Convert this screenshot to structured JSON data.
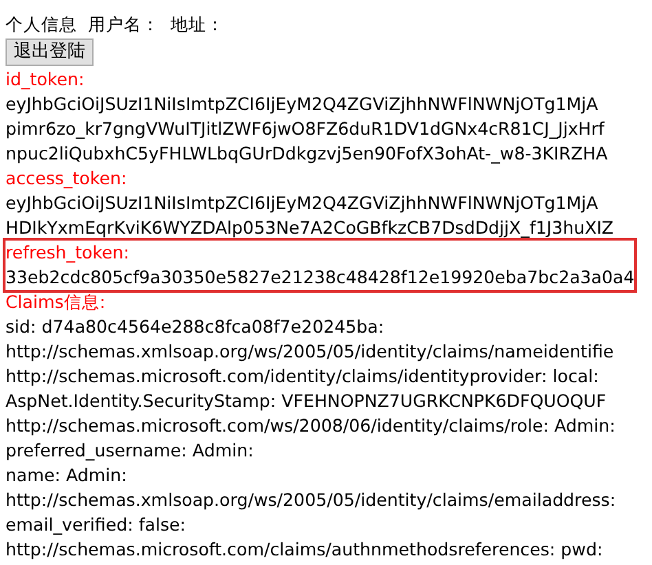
{
  "header": {
    "title": "个人信息",
    "fields": [
      "用户名：",
      "地址："
    ]
  },
  "logout_button": {
    "label": "退出登陆"
  },
  "sections": [
    {
      "label": "id_token:",
      "highlighted": false,
      "lines": [
        "eyJhbGciOiJSUzI1NiIsImtpZCI6IjEyM2Q4ZGViZjhhNWFlNWNjOTg1MjA",
        "pimr6zo_kr7gngVWuITJitlZWF6jwO8FZ6duR1DV1dGNx4cR81CJ_JjxHrf",
        "npuc2liQubxhC5yFHLWLbqGUrDdkgzvj5en90FofX3ohAt-_w8-3KIRZHA"
      ]
    },
    {
      "label": "access_token:",
      "highlighted": false,
      "lines": [
        "eyJhbGciOiJSUzI1NiIsImtpZCI6IjEyM2Q4ZGViZjhhNWFlNWNjOTg1MjA",
        "HDIkYxmEqrKviK6WYZDAlp053Ne7A2CoGBfkzCB7DsdDdjjX_f1J3huXIZ"
      ]
    },
    {
      "label": "refresh_token:",
      "highlighted": true,
      "lines": [
        "33eb2cdc805cf9a30350e5827e21238c48428f12e19920eba7bc2a3a0a4"
      ]
    },
    {
      "label": "Claims信息:",
      "highlighted": false,
      "lines": [
        "sid: d74a80c4564e288c8fca08f7e20245ba:",
        "http://schemas.xmlsoap.org/ws/2005/05/identity/claims/nameidentifie",
        "http://schemas.microsoft.com/identity/claims/identityprovider: local:",
        "AspNet.Identity.SecurityStamp: VFEHNOPNZ7UGRKCNPK6DFQUOQUF",
        "http://schemas.microsoft.com/ws/2008/06/identity/claims/role: Admin:",
        "preferred_username: Admin:",
        "name: Admin:",
        "http://schemas.xmlsoap.org/ws/2005/05/identity/claims/emailaddress:",
        "email_verified: false:",
        "http://schemas.microsoft.com/claims/authnmethodsreferences: pwd:"
      ]
    }
  ]
}
